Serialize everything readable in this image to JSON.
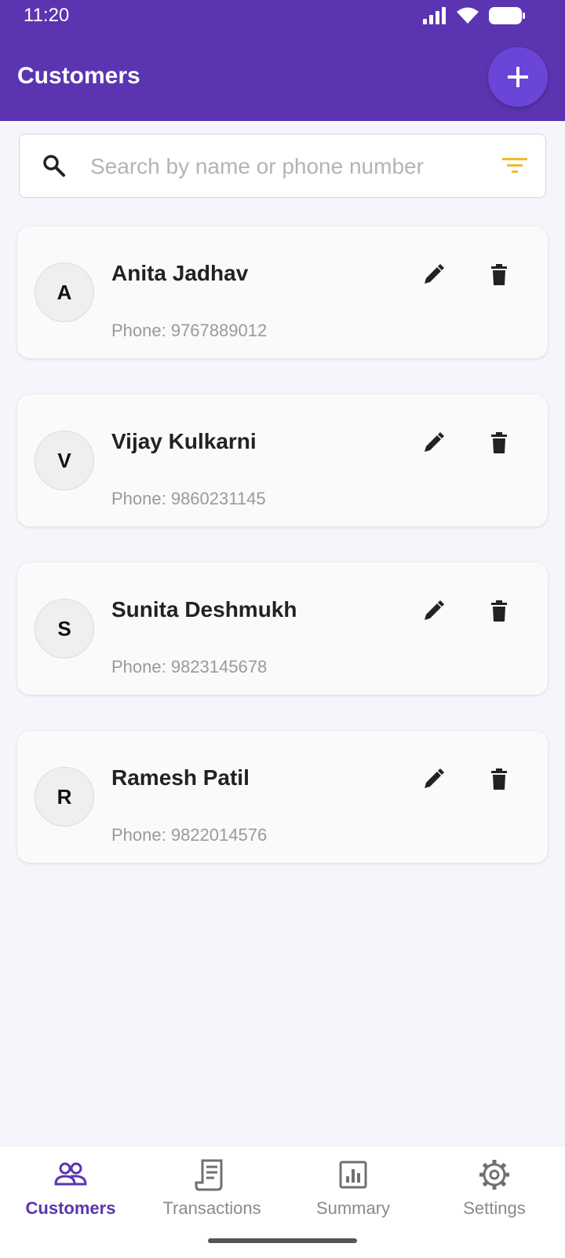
{
  "status_bar": {
    "time": "11:20"
  },
  "header": {
    "title": "Customers",
    "add_icon": "plus-icon"
  },
  "search": {
    "placeholder": "Search by name or phone number",
    "value": "",
    "icon": "search-icon",
    "filter_icon": "filter-icon"
  },
  "colors": {
    "primary": "#5b35b1",
    "fab": "#6a45d8",
    "filter": "#f5b731"
  },
  "customers": [
    {
      "initial": "A",
      "name": "Anita Jadhav",
      "phone": "Phone: 9767889012"
    },
    {
      "initial": "V",
      "name": "Vijay Kulkarni",
      "phone": "Phone: 9860231145"
    },
    {
      "initial": "S",
      "name": "Sunita Deshmukh",
      "phone": "Phone: 9823145678"
    },
    {
      "initial": "R",
      "name": "Ramesh Patil",
      "phone": "Phone: 9822014576"
    }
  ],
  "bottom_nav": {
    "items": [
      {
        "label": "Customers",
        "icon": "people-icon",
        "active": true
      },
      {
        "label": "Transactions",
        "icon": "receipt-icon",
        "active": false
      },
      {
        "label": "Summary",
        "icon": "chart-icon",
        "active": false
      },
      {
        "label": "Settings",
        "icon": "gear-icon",
        "active": false
      }
    ]
  }
}
